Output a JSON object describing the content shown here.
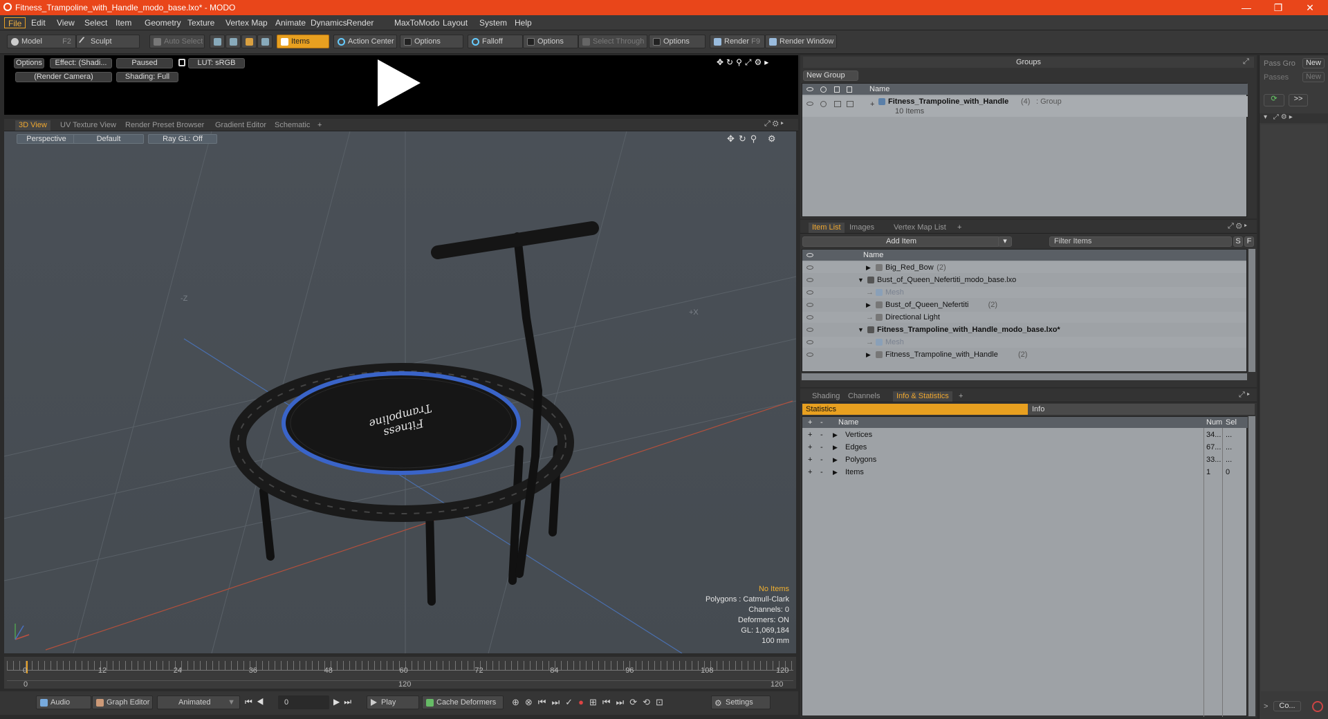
{
  "window": {
    "title": "Fitness_Trampoline_with_Handle_modo_base.lxo* - MODO",
    "minimize": "—",
    "maximize": "❐",
    "close": "✕"
  },
  "menu": [
    "File",
    "Edit",
    "View",
    "Select",
    "Item",
    "Geometry",
    "Texture",
    "Vertex Map",
    "Animate",
    "Dynamics",
    "Render",
    "MaxToModo",
    "Layout",
    "System",
    "Help"
  ],
  "toolbar": {
    "model": "Model",
    "model_key": "F2",
    "sculpt": "Sculpt",
    "auto_select": "Auto Select",
    "items": "Items",
    "action_center": "Action Center",
    "options1": "Options",
    "falloff": "Falloff",
    "options2": "Options",
    "select_through": "Select Through",
    "options3": "Options",
    "render": "Render",
    "render_key": "F9",
    "render_window": "Render Window"
  },
  "preview": {
    "options": "Options",
    "effect": "Effect: (Shadi...",
    "paused": "Paused",
    "lut": "LUT: sRGB",
    "camera": "(Render Camera)",
    "shading": "Shading: Full"
  },
  "view_tabs": [
    "3D View",
    "UV Texture View",
    "Render Preset Browser",
    "Gradient Editor",
    "Schematic",
    "+"
  ],
  "viewport": {
    "perspective": "Perspective",
    "default": "Default",
    "raygl": "Ray GL: Off",
    "axis_z": "-Z",
    "axis_x": "+X",
    "logo_line1": "Fitness",
    "logo_line2": "Trampoline"
  },
  "overlay": {
    "no_items": "No Items",
    "polygons": "Polygons : Catmull-Clark",
    "channels": "Channels: 0",
    "deformers": "Deformers: ON",
    "gl": "GL: 1,069,184",
    "unit": "100 mm"
  },
  "timeline": {
    "ticks": [
      "0",
      "12",
      "24",
      "36",
      "48",
      "60",
      "72",
      "84",
      "96",
      "108",
      "120"
    ],
    "range_start": "0",
    "range_mid": "120",
    "range_end": "120"
  },
  "bottom": {
    "audio": "Audio",
    "graph_editor": "Graph Editor",
    "animated": "Animated",
    "frame": "0",
    "play": "Play",
    "cache_deformers": "Cache Deformers",
    "settings": "Settings"
  },
  "groups": {
    "title": "Groups",
    "new_group": "New Group",
    "col_name": "Name",
    "item_name": "Fitness_Trampoline_with_Handle",
    "item_count": "(4)",
    "item_type": ": Group",
    "item_sub": "10 Items"
  },
  "right_strip": {
    "pass_group": "Pass Gro",
    "new1": "New",
    "passes": "Passes",
    "new2": "New",
    "collapse": "Co..."
  },
  "item_list": {
    "tabs": [
      "Item List",
      "Images",
      "Vertex Map List",
      "+"
    ],
    "add_item": "Add Item",
    "filter": "Filter Items",
    "s": "S",
    "f": "F",
    "col_name": "Name",
    "rows": [
      {
        "label": "Big_Red_Bow",
        "count": "(2)",
        "indent": 2,
        "arrow": "▶",
        "bold": false,
        "dim": false
      },
      {
        "label": "Bust_of_Queen_Nefertiti_modo_base.lxo",
        "count": "",
        "indent": 1,
        "arrow": "▼",
        "bold": false,
        "dim": false
      },
      {
        "label": "Mesh",
        "count": "",
        "indent": 2,
        "arrow": "",
        "bold": false,
        "dim": true
      },
      {
        "label": "Bust_of_Queen_Nefertiti",
        "count": "(2)",
        "indent": 2,
        "arrow": "▶",
        "bold": false,
        "dim": false
      },
      {
        "label": "Directional Light",
        "count": "",
        "indent": 2,
        "arrow": "",
        "bold": false,
        "dim": false
      },
      {
        "label": "Fitness_Trampoline_with_Handle_modo_base.lxo*",
        "count": "",
        "indent": 1,
        "arrow": "▼",
        "bold": true,
        "dim": false
      },
      {
        "label": "Mesh",
        "count": "",
        "indent": 2,
        "arrow": "",
        "bold": false,
        "dim": true
      },
      {
        "label": "Fitness_Trampoline_with_Handle",
        "count": "(2)",
        "indent": 2,
        "arrow": "▶",
        "bold": false,
        "dim": false
      }
    ]
  },
  "stats": {
    "tabs": [
      "Shading",
      "Channels",
      "Info & Statistics",
      "+"
    ],
    "statistics": "Statistics",
    "info": "Info",
    "col_name": "Name",
    "col_num": "Num",
    "col_sel": "Sel",
    "rows": [
      {
        "name": "Vertices",
        "num": "34...",
        "sel": "..."
      },
      {
        "name": "Edges",
        "num": "67...",
        "sel": "..."
      },
      {
        "name": "Polygons",
        "num": "33...",
        "sel": "..."
      },
      {
        "name": "Items",
        "num": "1",
        "sel": "0"
      }
    ]
  }
}
